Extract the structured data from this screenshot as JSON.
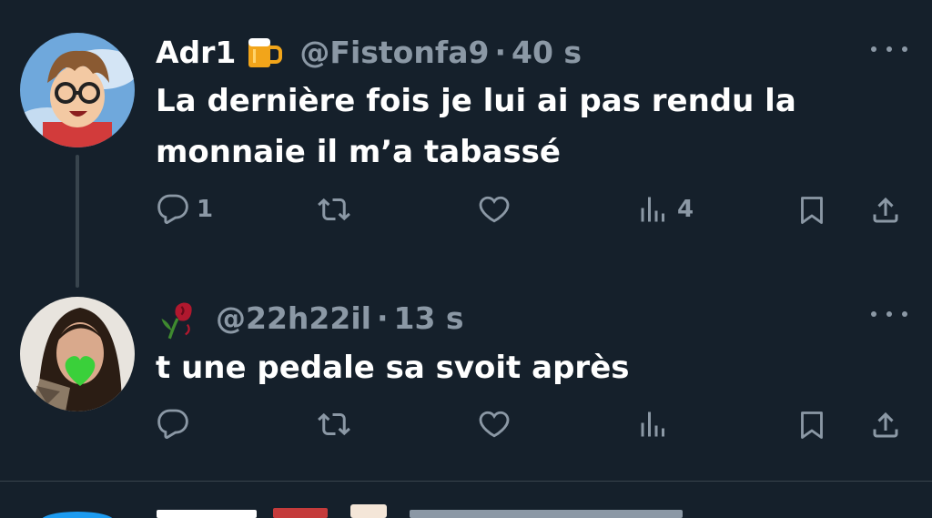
{
  "tweets": [
    {
      "display_name": "Adr1",
      "name_emoji": "beer-mug-icon",
      "handle": "@Fistonfa9",
      "separator": "·",
      "time": "40 s",
      "text_line1": "La dernière fois je lui ai pas rendu la",
      "text_line2": "monnaie il m’a tabassé",
      "reply_count": "1",
      "retweet_count": "",
      "like_count": "",
      "view_count": "4"
    },
    {
      "display_name_emoji": "wilted-rose-icon",
      "handle": "@22h22il",
      "separator": "·",
      "time": "13 s",
      "text": "t une pedale sa svoit après",
      "reply_count": "",
      "retweet_count": "",
      "like_count": "",
      "view_count": ""
    }
  ],
  "colors": {
    "background": "#15202b",
    "primary_text": "#ffffff",
    "secondary_text": "#8b98a5",
    "divider": "#38444d"
  }
}
